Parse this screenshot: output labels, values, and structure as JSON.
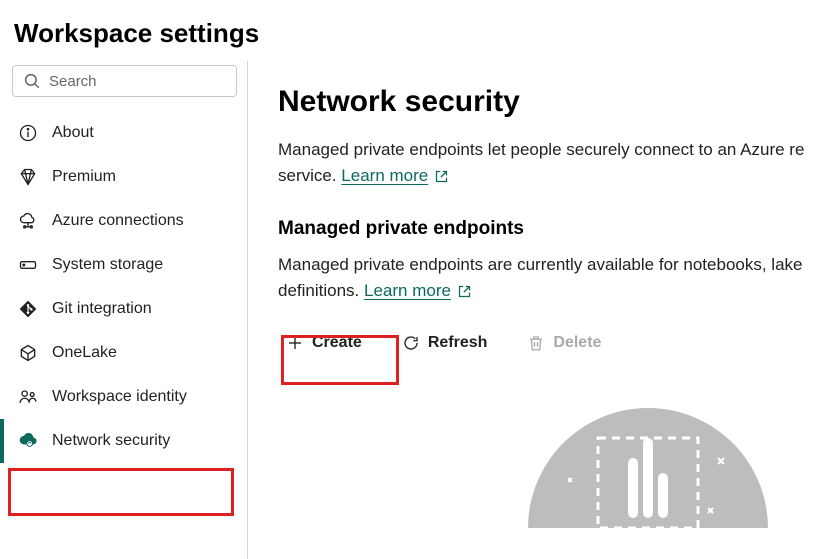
{
  "page_title": "Workspace settings",
  "search": {
    "placeholder": "Search"
  },
  "sidebar": {
    "items": [
      {
        "label": "About"
      },
      {
        "label": "Premium"
      },
      {
        "label": "Azure connections"
      },
      {
        "label": "System storage"
      },
      {
        "label": "Git integration"
      },
      {
        "label": "OneLake"
      },
      {
        "label": "Workspace identity"
      },
      {
        "label": "Network security"
      }
    ]
  },
  "main": {
    "heading": "Network security",
    "intro_line1": "Managed private endpoints let people securely connect to an Azure re",
    "intro_line2_prefix": "service.  ",
    "learn_more": "Learn more ",
    "sub_heading": "Managed private endpoints",
    "sub_line1": "Managed private endpoints are currently available for notebooks, lake",
    "sub_line2_prefix": "definitions.  "
  },
  "toolbar": {
    "create": "Create",
    "refresh": "Refresh",
    "delete": "Delete"
  },
  "colors": {
    "accent": "#0c695d",
    "highlight": "#e02020"
  }
}
